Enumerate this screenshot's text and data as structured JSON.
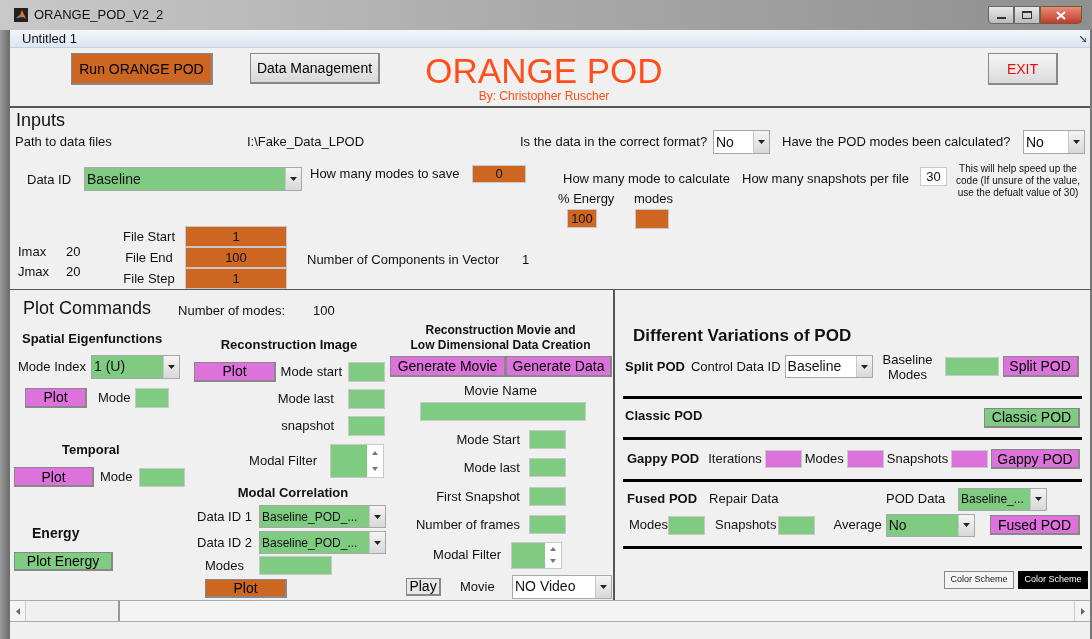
{
  "window": {
    "title": "ORANGE_POD_V2_2"
  },
  "menu_bar": {
    "title": "Untitled 1"
  },
  "header": {
    "run_button": "Run ORANGE POD",
    "data_button": "Data Management",
    "app_title": "ORANGE POD",
    "byline": "By: Christopher Ruscher",
    "exit_button": "EXIT"
  },
  "inputs": {
    "title": "Inputs",
    "path_label": "Path to data files",
    "path_value": "I:\\Fake_Data_LPOD",
    "format_question": "Is the data in the correct format?",
    "format_value": "No",
    "modes_question": "Have the POD modes been calculated?",
    "modes_value": "No",
    "data_id_label": "Data ID",
    "data_id_value": "Baseline",
    "save_label": "How many modes to save",
    "save_value": "0",
    "calc_label": "How many mode to calculate",
    "energy_label": "% Energy",
    "energy_value": "100",
    "calc_modes_label": "modes",
    "snapshots_label": "How many snapshots per file",
    "snapshots_value": "30",
    "snapshots_hint": "This will help speed up the code (If unsure of the value, use the defualt value of 30)",
    "imax_label": "Imax",
    "imax_value": "20",
    "jmax_label": "Jmax",
    "jmax_value": "20",
    "file_fields": [
      {
        "label": "File Start",
        "value": "1"
      },
      {
        "label": "File End",
        "value": "100"
      },
      {
        "label": "File Step",
        "value": "1"
      }
    ],
    "components_label": "Number of Components in Vector",
    "components_value": "1"
  },
  "plot_commands": {
    "title": "Plot Commands",
    "modes_label": "Number of modes:",
    "modes_value": "100",
    "spatial": {
      "title": "Spatial Eigenfunctions",
      "mode_index_label": "Mode Index",
      "mode_index_value": "1 (U)",
      "plot_button": "Plot",
      "mode_label": "Mode"
    },
    "temporal": {
      "title": "Temporal",
      "plot_button": "Plot",
      "mode_label": "Mode"
    },
    "energy": {
      "title": "Energy",
      "plot_button": "Plot Energy"
    },
    "reconstruction": {
      "title": "Reconstruction Image",
      "plot_button": "Plot",
      "fields": [
        {
          "label": "Mode start"
        },
        {
          "label": "Mode last"
        },
        {
          "label": "snapshot"
        }
      ],
      "filter_label": "Modal Filter"
    },
    "correlation": {
      "title": "Modal Correlation",
      "selects": [
        {
          "label": "Data ID 1",
          "value": "Baseline_POD_..."
        },
        {
          "label": "Data ID 2",
          "value": "Baseline_POD_..."
        }
      ],
      "modes_label": "Modes",
      "plot_button": "Plot"
    },
    "movie": {
      "title_lines": [
        "Reconstruction Movie and",
        "Low Dimensional Data Creation"
      ],
      "buttons": [
        "Generate Movie",
        "Generate Data"
      ],
      "name_label": "Movie Name",
      "fields": [
        {
          "label": "Mode Start"
        },
        {
          "label": "Mode last"
        },
        {
          "label": "First Snapshot"
        },
        {
          "label": "Number of frames"
        }
      ],
      "filter_label": "Modal Filter",
      "play_button": "Play",
      "movie_label": "Movie",
      "movie_value": "NO Video"
    }
  },
  "variations": {
    "title": "Different Variations of POD",
    "split": {
      "title": "Split POD",
      "control_label": "Control Data ID",
      "control_value": "Baseline",
      "modes_label": "Baseline Modes",
      "button": "Split POD"
    },
    "classic": {
      "title": "Classic POD",
      "button": "Classic POD"
    },
    "gappy": {
      "title": "Gappy POD",
      "fields": [
        {
          "label": "Iterations"
        },
        {
          "label": "Modes"
        },
        {
          "label": "Snapshots"
        }
      ],
      "button": "Gappy POD"
    },
    "fused": {
      "title": "Fused POD",
      "repair_label": "Repair Data",
      "pod_data_label": "POD Data",
      "pod_data_value": "Baseline_...",
      "modes_label": "Modes",
      "snapshots_label": "Snapshots",
      "average_label": "Average",
      "average_value": "No",
      "button": "Fused POD"
    },
    "color_scheme_buttons": [
      {
        "label": "Color Scheme",
        "kind": "light"
      },
      {
        "label": "Color Scheme",
        "kind": "dark"
      }
    ]
  }
}
